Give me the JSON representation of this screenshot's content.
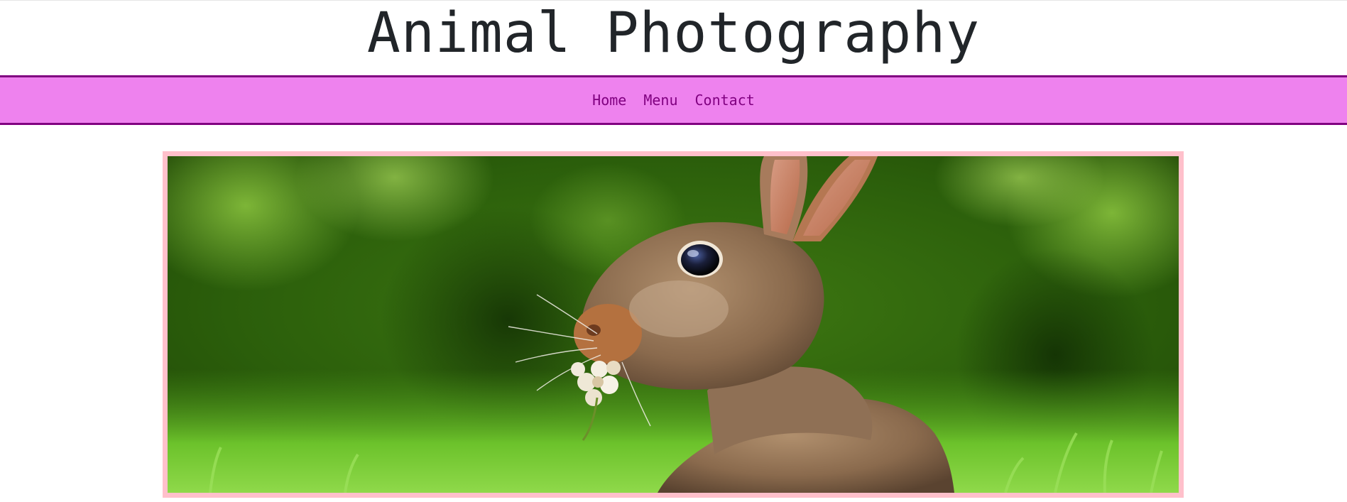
{
  "header": {
    "title": "Animal Photography"
  },
  "nav": {
    "items": [
      {
        "label": "Home"
      },
      {
        "label": "Menu"
      },
      {
        "label": "Contact"
      }
    ]
  },
  "hero": {
    "image_alt": "Rabbit holding a clover flower in its mouth",
    "icon": "rabbit-photo"
  },
  "colors": {
    "nav_background": "#ee82ee",
    "nav_border": "#800080",
    "nav_link": "#800080",
    "image_border": "#ffc0cb",
    "title_text": "#212529"
  }
}
